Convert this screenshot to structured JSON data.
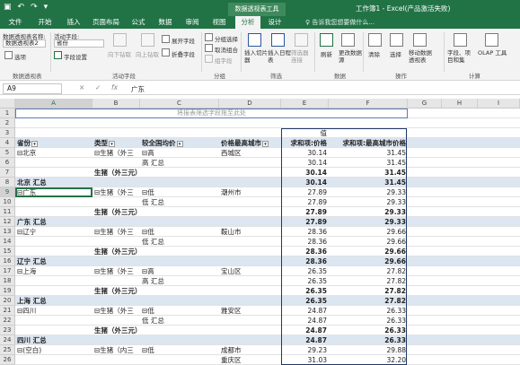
{
  "titlebar": {
    "save_icon": "save-icon",
    "undo": "↶",
    "redo": "↷",
    "tool_context": "数据透视表工具",
    "window_title": "工作簿1 - Excel(产品激活失败)"
  },
  "tabs": [
    "文件",
    "开始",
    "插入",
    "页面布局",
    "公式",
    "数据",
    "审阅",
    "视图",
    "分析",
    "设计"
  ],
  "tell_me": "♀ 告诉我您想要做什么...",
  "ribbon": {
    "pt_name_label": "数据透视表名称:",
    "pt_name_value": "数据透视表2",
    "options_label": "选项",
    "active_field_label": "活动字段:",
    "active_field_value": "省份",
    "field_settings_label": "字段设置",
    "drill_down": "向下钻取",
    "drill_up": "向上钻取",
    "expand_field": "展开字段",
    "collapse_field": "折叠字段",
    "group_selection": "分组选择",
    "ungroup": "取消组合",
    "group_field": "组字段",
    "insert_slicer": "插入切片器",
    "insert_timeline": "插入日程表",
    "filter_connections": "筛选器连接",
    "refresh": "刷新",
    "change_source": "更改数据源",
    "clear": "清除",
    "select": "选择",
    "move_pt": "移动数据透视表",
    "fields_items": "字段、项目和集",
    "olap": "OLAP 工具",
    "groups": {
      "pivottable": "数据透视表",
      "active_field": "活动字段",
      "group": "分组",
      "filter": "筛选",
      "data": "数据",
      "actions": "操作",
      "calc": "计算"
    }
  },
  "formula_bar": {
    "name_box": "A9",
    "cancel": "×",
    "enter": "✓",
    "fx": "fx",
    "formula": "广东"
  },
  "columns": [
    "A",
    "B",
    "C",
    "D",
    "E",
    "F",
    "G",
    "H",
    "I"
  ],
  "filter_area_text": "将报表筛选字段拖至此处",
  "values_label": "值",
  "headers": {
    "province": "省份",
    "type": "类型",
    "comparison": "较全国均价",
    "highest_city": "价格最高城市",
    "sum_price": "求和项:价格",
    "sum_highest": "求和项:最高城市价格"
  },
  "rows": [
    {
      "n": "1",
      "a": "",
      "b": "",
      "c": "",
      "d": "",
      "e": "",
      "f": "",
      "cls": ""
    },
    {
      "n": "2",
      "a": "",
      "b": "",
      "c": "",
      "d": "",
      "e": "",
      "f": "",
      "cls": ""
    },
    {
      "n": "3",
      "a": "",
      "b": "",
      "c": "",
      "d": "",
      "e": "值",
      "f": "",
      "cls": ""
    },
    {
      "n": "4",
      "a": "",
      "b": "",
      "c": "",
      "d": "",
      "e": "",
      "f": "",
      "cls": "hdr"
    },
    {
      "n": "5",
      "a": "⊟北京",
      "b": "⊟生猪（外三",
      "c": "⊟高",
      "d": "西城区",
      "e": "30.14",
      "f": "31.45",
      "cls": ""
    },
    {
      "n": "6",
      "a": "",
      "b": "",
      "c": "高 汇总",
      "d": "",
      "e": "30.14",
      "f": "31.45",
      "cls": ""
    },
    {
      "n": "7",
      "a": "",
      "b": "生猪（外三元）汇总",
      "c": "",
      "d": "",
      "e": "30.14",
      "f": "31.45",
      "cls": "b"
    },
    {
      "n": "8",
      "a": "北京 汇总",
      "b": "",
      "c": "",
      "d": "",
      "e": "30.14",
      "f": "31.45",
      "cls": "sub"
    },
    {
      "n": "9",
      "a": "⊟广东",
      "b": "⊟生猪（外三",
      "c": "⊟低",
      "d": "潮州市",
      "e": "27.89",
      "f": "29.33",
      "cls": "sel"
    },
    {
      "n": "10",
      "a": "",
      "b": "",
      "c": "低 汇总",
      "d": "",
      "e": "27.89",
      "f": "29.33",
      "cls": ""
    },
    {
      "n": "11",
      "a": "",
      "b": "生猪（外三元）汇总",
      "c": "",
      "d": "",
      "e": "27.89",
      "f": "29.33",
      "cls": "b"
    },
    {
      "n": "12",
      "a": "广东 汇总",
      "b": "",
      "c": "",
      "d": "",
      "e": "27.89",
      "f": "29.33",
      "cls": "sub"
    },
    {
      "n": "13",
      "a": "⊟辽宁",
      "b": "⊟生猪（外三",
      "c": "⊟低",
      "d": "鞍山市",
      "e": "28.36",
      "f": "29.66",
      "cls": ""
    },
    {
      "n": "14",
      "a": "",
      "b": "",
      "c": "低 汇总",
      "d": "",
      "e": "28.36",
      "f": "29.66",
      "cls": ""
    },
    {
      "n": "15",
      "a": "",
      "b": "生猪（外三元）汇总",
      "c": "",
      "d": "",
      "e": "28.36",
      "f": "29.66",
      "cls": "b"
    },
    {
      "n": "16",
      "a": "辽宁 汇总",
      "b": "",
      "c": "",
      "d": "",
      "e": "28.36",
      "f": "29.66",
      "cls": "sub"
    },
    {
      "n": "17",
      "a": "⊟上海",
      "b": "⊟生猪（外三",
      "c": "⊟高",
      "d": "宝山区",
      "e": "26.35",
      "f": "27.82",
      "cls": ""
    },
    {
      "n": "18",
      "a": "",
      "b": "",
      "c": "高 汇总",
      "d": "",
      "e": "26.35",
      "f": "27.82",
      "cls": ""
    },
    {
      "n": "19",
      "a": "",
      "b": "生猪（外三元）汇总",
      "c": "",
      "d": "",
      "e": "26.35",
      "f": "27.82",
      "cls": "b"
    },
    {
      "n": "20",
      "a": "上海 汇总",
      "b": "",
      "c": "",
      "d": "",
      "e": "26.35",
      "f": "27.82",
      "cls": "sub"
    },
    {
      "n": "21",
      "a": "⊟四川",
      "b": "⊟生猪（外三",
      "c": "⊟低",
      "d": "雅安区",
      "e": "24.87",
      "f": "26.33",
      "cls": ""
    },
    {
      "n": "22",
      "a": "",
      "b": "",
      "c": "低 汇总",
      "d": "",
      "e": "24.87",
      "f": "26.33",
      "cls": ""
    },
    {
      "n": "23",
      "a": "",
      "b": "生猪（外三元）汇总",
      "c": "",
      "d": "",
      "e": "24.87",
      "f": "26.33",
      "cls": "b"
    },
    {
      "n": "24",
      "a": "四川 汇总",
      "b": "",
      "c": "",
      "d": "",
      "e": "24.87",
      "f": "26.33",
      "cls": "sub"
    },
    {
      "n": "25",
      "a": "⊟(空白)",
      "b": "⊟生猪（内三",
      "c": "⊟低",
      "d": "成都市",
      "e": "29.23",
      "f": "29.88",
      "cls": ""
    },
    {
      "n": "26",
      "a": "",
      "b": "",
      "c": "",
      "d": "重庆区",
      "e": "31.03",
      "f": "32.20",
      "cls": ""
    }
  ]
}
